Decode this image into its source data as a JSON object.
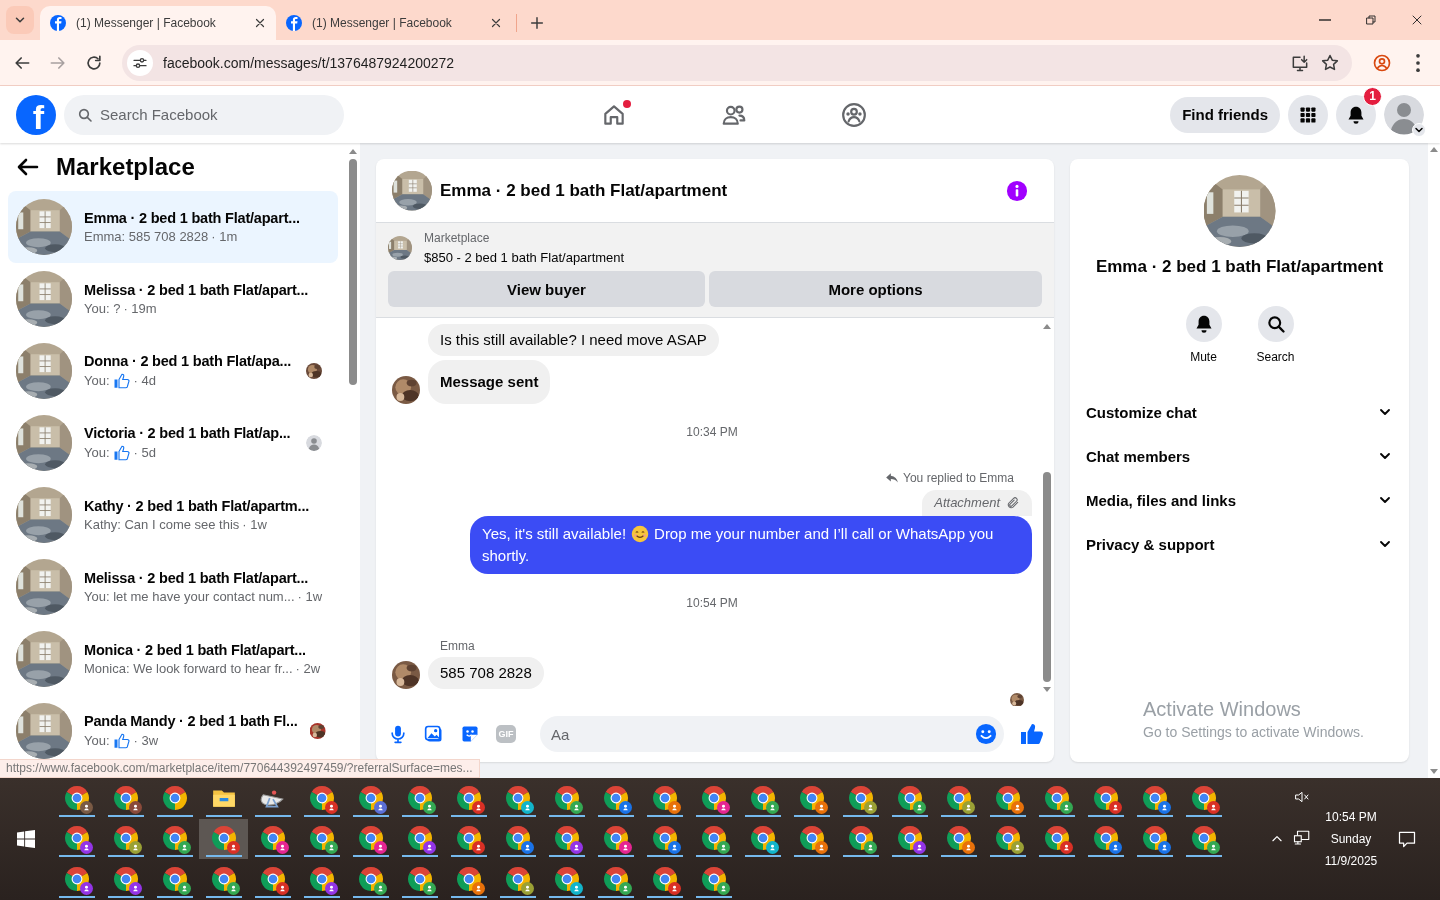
{
  "browser": {
    "tabs": [
      {
        "title": "(1) Messenger | Facebook",
        "selected": true
      },
      {
        "title": "(1) Messenger | Facebook",
        "selected": false
      }
    ],
    "url": "facebook.com/messages/t/1376487924200272",
    "status_link": "https://www.facebook.com/marketplace/item/770644392497459/?referralSurface=mes..."
  },
  "header": {
    "logo": "f",
    "search": {
      "placeholder": "Search Facebook"
    },
    "nav": [
      {
        "kind": "home",
        "dot": true
      },
      {
        "kind": "friends",
        "dot": false
      },
      {
        "kind": "groups",
        "dot": false
      }
    ],
    "find_friends": "Find friends",
    "notifications_badge": "1"
  },
  "sidebar": {
    "title": "Marketplace",
    "chats": [
      {
        "title": "Emma · 2 bed 1 bath Flat/apart...",
        "preview": "Emma: 585 708 2828",
        "like": false,
        "time": "· 1m",
        "selected": true
      },
      {
        "title": "Melissa · 2 bed 1 bath Flat/apart...",
        "preview": "You: ?",
        "like": false,
        "time": "· 19m",
        "selected": false
      },
      {
        "title": "Donna · 2 bed 1 bath Flat/apa...",
        "preview": "You:",
        "like": true,
        "time": "· 4d",
        "selected": false
      },
      {
        "title": "Victoria · 2 bed 1 bath Flat/ap...",
        "preview": "You:",
        "like": true,
        "time": "· 5d",
        "selected": false,
        "seen": {
          "kind": "default"
        }
      },
      {
        "title": "Kathy · 2 bed 1 bath Flat/apartm...",
        "preview": "Kathy: Can I come see this",
        "like": false,
        "time": "· 1w",
        "selected": false
      },
      {
        "title": "Melissa · 2 bed 1 bath Flat/apart...",
        "preview": "You: let me have your contact num...",
        "like": false,
        "time": "· 1w",
        "selected": false
      },
      {
        "title": "Monica · 2 bed 1 bath Flat/apart...",
        "preview": "Monica: We look forward to hear fr...",
        "like": false,
        "time": "· 2w",
        "selected": false
      },
      {
        "title": "Panda Mandy · 2 bed 1 bath Fl...",
        "preview": "You:",
        "like": true,
        "time": "· 3w",
        "selected": false
      }
    ]
  },
  "chat": {
    "title": "Emma · 2 bed 1 bath Flat/apartment",
    "listing": {
      "source": "Marketplace",
      "title": "$850 - 2 bed 1 bath Flat/apartment"
    },
    "buttons": [
      "View buyer",
      "More options"
    ],
    "messages": [
      {
        "kind": "incoming",
        "text": "Is this still available? I need move ASAP",
        "avatar": false,
        "bold": false
      },
      {
        "kind": "incoming",
        "text": "Message sent",
        "avatar": true,
        "bold": true
      },
      {
        "kind": "timestamp",
        "text": "10:34 PM"
      },
      {
        "kind": "reply_note",
        "text": "You replied to Emma"
      },
      {
        "kind": "attachment",
        "text": "Attachment"
      },
      {
        "kind": "outgoing",
        "text": "Yes, it's still available!",
        "emoji": true,
        "text_after": "Drop me your number and I’ll call or WhatsApp you",
        "text_cont": "shortly."
      },
      {
        "kind": "timestamp",
        "text": "10:54 PM"
      },
      {
        "kind": "sender",
        "text": "Emma"
      },
      {
        "kind": "incoming",
        "text": "585 708 2828",
        "avatar": true,
        "bold": false
      },
      {
        "kind": "seen"
      }
    ],
    "composer": {
      "gif_label": "GIF",
      "placeholder": "Aa"
    }
  },
  "details": {
    "name": "Emma · 2 bed 1 bath Flat/apartment",
    "actions": [
      {
        "kind": "mute",
        "label": "Mute"
      },
      {
        "kind": "search",
        "label": "Search"
      }
    ],
    "sections": [
      {
        "label": "Customize chat",
        "expanded": false
      },
      {
        "label": "Chat members",
        "expanded": false
      },
      {
        "label": "Media, files and links",
        "expanded": false
      },
      {
        "label": "Privacy & support",
        "expanded": false
      }
    ]
  },
  "activation_notice": {
    "title": "Activate Windows",
    "text": "Go to Settings to activate Windows."
  },
  "taskbar": {
    "rows": [
      [
        {
          "kind": "chrome",
          "color": "#7a5a44",
          "selected": false
        },
        {
          "kind": "chrome",
          "color": "#8a4a3a",
          "selected": false
        },
        {
          "kind": "chrome",
          "selected": false
        },
        {
          "kind": "folder",
          "selected": false
        },
        {
          "kind": "app",
          "selected": false
        },
        {
          "kind": "chrome",
          "color": "#d93025",
          "selected": false
        },
        {
          "kind": "chrome",
          "color": "#5b6fd6",
          "selected": false
        },
        {
          "kind": "chrome",
          "color": "#34a853",
          "selected": false
        },
        {
          "kind": "chrome",
          "color": "#d93025",
          "selected": false
        },
        {
          "kind": "chrome",
          "color": "#12b5cb",
          "selected": false
        },
        {
          "kind": "chrome",
          "color": "#34a853",
          "selected": false
        },
        {
          "kind": "chrome",
          "color": "#1a73e8",
          "selected": false
        },
        {
          "kind": "chrome",
          "color": "#e8710a",
          "selected": false
        },
        {
          "kind": "chrome",
          "color": "#e52592",
          "selected": false
        },
        {
          "kind": "chrome",
          "color": "#34a853",
          "selected": false
        },
        {
          "kind": "chrome",
          "color": "#e8710a",
          "selected": false
        },
        {
          "kind": "chrome",
          "color": "#9aa035",
          "selected": false
        },
        {
          "kind": "chrome",
          "color": "#34a853",
          "selected": false
        },
        {
          "kind": "chrome",
          "color": "#9aa035",
          "selected": false
        },
        {
          "kind": "chrome",
          "color": "#e8710a",
          "selected": false
        },
        {
          "kind": "chrome",
          "color": "#34a853",
          "selected": false
        },
        {
          "kind": "chrome",
          "color": "#d93025",
          "selected": false
        },
        {
          "kind": "chrome",
          "color": "#1a73e8",
          "selected": false
        },
        {
          "kind": "chrome",
          "color": "#d93025",
          "selected": false
        }
      ],
      [
        {
          "kind": "chrome",
          "color": "#9334e6",
          "selected": false
        },
        {
          "kind": "chrome",
          "color": "#9aa035",
          "selected": false
        },
        {
          "kind": "chrome",
          "color": "#34a853",
          "selected": false
        },
        {
          "kind": "chrome",
          "color": "#d93025",
          "selected": true
        },
        {
          "kind": "chrome",
          "color": "#e52592",
          "selected": false
        },
        {
          "kind": "chrome",
          "color": "#34a853",
          "selected": false
        },
        {
          "kind": "chrome",
          "color": "#e52592",
          "selected": false
        },
        {
          "kind": "chrome",
          "color": "#9334e6",
          "selected": false
        },
        {
          "kind": "chrome",
          "color": "#d93025",
          "selected": false
        },
        {
          "kind": "chrome",
          "color": "#1a73e8",
          "selected": false
        },
        {
          "kind": "chrome",
          "color": "#9334e6",
          "selected": false
        },
        {
          "kind": "chrome",
          "color": "#e52592",
          "selected": false
        },
        {
          "kind": "chrome",
          "color": "#1a73e8",
          "selected": false
        },
        {
          "kind": "chrome",
          "color": "#34a853",
          "selected": false
        },
        {
          "kind": "chrome",
          "color": "#12b5cb",
          "selected": false
        },
        {
          "kind": "chrome",
          "color": "#e8710a",
          "selected": false
        },
        {
          "kind": "chrome",
          "color": "#34a853",
          "selected": false
        },
        {
          "kind": "chrome",
          "color": "#9334e6",
          "selected": false
        },
        {
          "kind": "chrome",
          "color": "#e8710a",
          "selected": false
        },
        {
          "kind": "chrome",
          "color": "#9aa035",
          "selected": false
        },
        {
          "kind": "chrome",
          "color": "#d93025",
          "selected": false
        },
        {
          "kind": "chrome",
          "color": "#1a73e8",
          "selected": false
        },
        {
          "kind": "chrome",
          "color": "#1a73e8",
          "selected": false
        },
        {
          "kind": "chrome",
          "color": "#34a853",
          "selected": false
        }
      ],
      [
        {
          "kind": "chrome",
          "color": "#9334e6",
          "selected": false
        },
        {
          "kind": "chrome",
          "color": "#9334e6",
          "selected": false
        },
        {
          "kind": "chrome",
          "color": "#34a853",
          "selected": false
        },
        {
          "kind": "chrome",
          "color": "#34a853",
          "selected": false
        },
        {
          "kind": "chrome",
          "color": "#d93025",
          "selected": false
        },
        {
          "kind": "chrome",
          "color": "#9334e6",
          "selected": false
        },
        {
          "kind": "chrome",
          "color": "#34a853",
          "selected": false
        },
        {
          "kind": "chrome",
          "color": "#34a853",
          "selected": false
        },
        {
          "kind": "chrome",
          "color": "#e8710a",
          "selected": false
        },
        {
          "kind": "chrome",
          "color": "#9aa035",
          "selected": false
        },
        {
          "kind": "chrome",
          "color": "#12b5cb",
          "selected": false
        },
        {
          "kind": "chrome",
          "color": "#34a853",
          "selected": false
        },
        {
          "kind": "chrome",
          "color": "#d93025",
          "selected": false
        },
        {
          "kind": "chrome",
          "color": "#34a853",
          "selected": false
        }
      ]
    ],
    "clock": {
      "time": "10:54 PM",
      "day": "Sunday",
      "date": "11/9/2025"
    }
  }
}
